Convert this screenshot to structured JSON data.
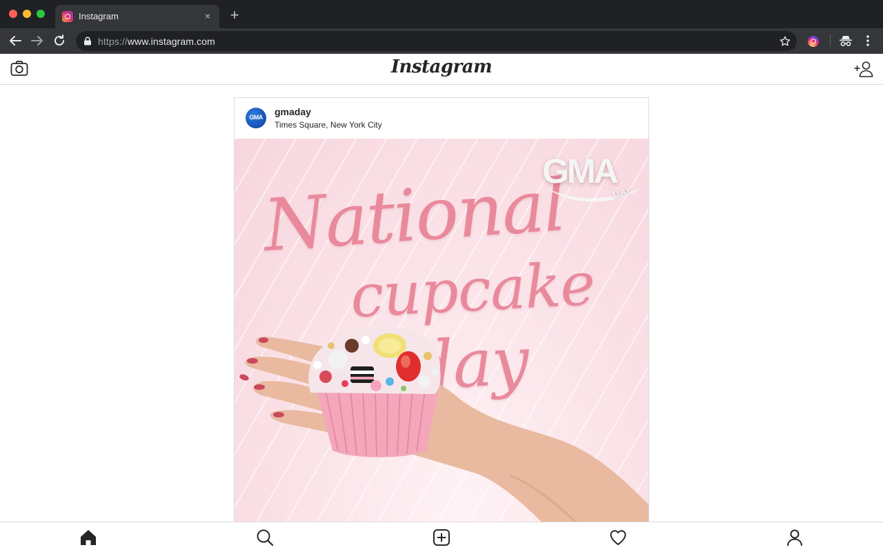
{
  "browser": {
    "tab_title": "Instagram",
    "url_scheme": "https://",
    "url_host": "www.instagram.com",
    "tab_close": "×",
    "new_tab": "+"
  },
  "header": {
    "logo": "Instagram",
    "left_icon": "camera-icon",
    "right_icon": "add-user-icon"
  },
  "post": {
    "username": "gmaday",
    "location": "Times Square, New York City",
    "avatar_text": "GMA",
    "image": {
      "badge": "GMA",
      "badge_sub": "DAY",
      "headline_1": "National",
      "headline_2": "cupcake",
      "headline_3": "day"
    }
  },
  "bottom_nav": {
    "items": [
      "home-icon",
      "search-icon",
      "new-post-icon",
      "activity-heart-icon",
      "profile-icon"
    ]
  },
  "colors": {
    "chrome_dark": "#202124",
    "chrome_toolbar": "#35363a",
    "headline_pink": "#e98a9c",
    "border": "#dbdbdb",
    "text": "#262626"
  }
}
